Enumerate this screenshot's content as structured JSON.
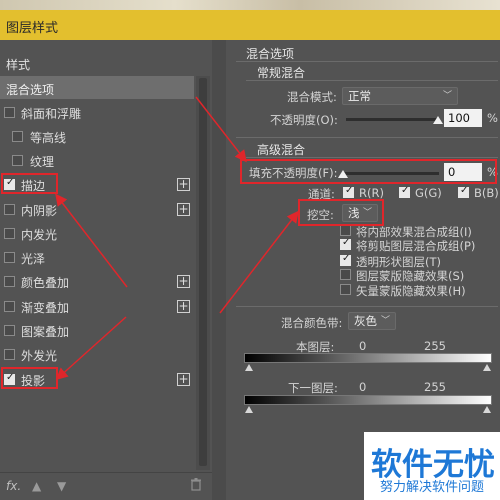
{
  "title_bar": {
    "title": "图层样式"
  },
  "left_panel": {
    "header": "样式",
    "blend_options": "混合选项",
    "items": [
      {
        "label": "斜面和浮雕",
        "checked": false,
        "has_plus": false
      },
      {
        "label": "等高线",
        "checked": false,
        "has_plus": false
      },
      {
        "label": "纹理",
        "checked": false,
        "has_plus": false
      },
      {
        "label": "描边",
        "checked": true,
        "has_plus": true
      },
      {
        "label": "内阴影",
        "checked": false,
        "has_plus": true
      },
      {
        "label": "内发光",
        "checked": false,
        "has_plus": false
      },
      {
        "label": "光泽",
        "checked": false,
        "has_plus": false
      },
      {
        "label": "颜色叠加",
        "checked": false,
        "has_plus": true
      },
      {
        "label": "渐变叠加",
        "checked": false,
        "has_plus": true
      },
      {
        "label": "图案叠加",
        "checked": false,
        "has_plus": false
      },
      {
        "label": "外发光",
        "checked": false,
        "has_plus": false
      },
      {
        "label": "投影",
        "checked": true,
        "has_plus": true
      }
    ],
    "bottom": {
      "fx": "fx.",
      "up_icon": "arrow-up-icon",
      "down_icon": "arrow-down-icon",
      "trash_icon": "trash-icon"
    }
  },
  "right_panel": {
    "section_title": "混合选项",
    "general": {
      "title": "常规混合",
      "mode_label": "混合模式:",
      "mode_value": "正常",
      "opacity_label": "不透明度(O):",
      "opacity_value": "100",
      "opacity_level": 1.0,
      "pct": "%"
    },
    "advanced": {
      "title": "高级混合",
      "fill_label": "填充不透明度(F):",
      "fill_value": "0",
      "fill_level": 0.0,
      "pct": "%",
      "channels_label": "通道:",
      "channels": [
        {
          "label": "R(R)",
          "checked": true
        },
        {
          "label": "G(G)",
          "checked": true
        },
        {
          "label": "B(B)",
          "checked": true
        }
      ],
      "knockout_label": "挖空:",
      "knockout_value": "浅",
      "options": [
        {
          "label": "将内部效果混合成组(I)",
          "checked": false
        },
        {
          "label": "将剪贴图层混合成组(P)",
          "checked": true
        },
        {
          "label": "透明形状图层(T)",
          "checked": true
        },
        {
          "label": "图层蒙版隐藏效果(S)",
          "checked": false
        },
        {
          "label": "矢量蒙版隐藏效果(H)",
          "checked": false
        }
      ]
    },
    "blend_if": {
      "label": "混合颜色带:",
      "value": "灰色",
      "this_layer_label": "本图层:",
      "this_low": "0",
      "this_high": "255",
      "under_layer_label": "下一图层:",
      "under_low": "0",
      "under_high": "255"
    }
  },
  "watermark": {
    "logo": "软件无忧",
    "sub": "努力解决软件问题"
  },
  "colors": {
    "title_bar": "#e3bf2e",
    "annotation": "#e0262b",
    "watermark_blue": "#1e78d6"
  }
}
